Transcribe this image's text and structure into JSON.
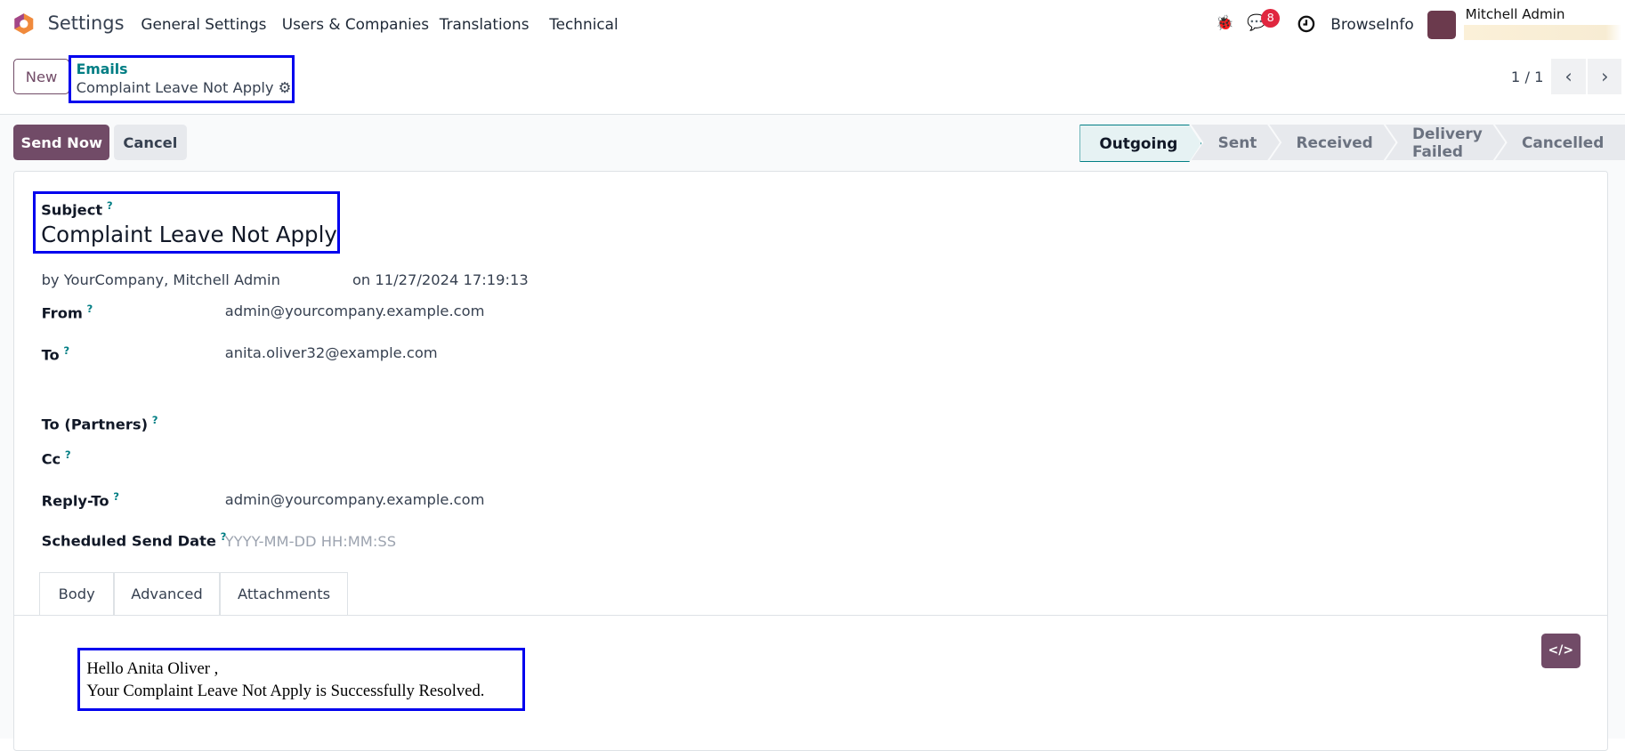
{
  "nav": {
    "app": "Settings",
    "items": [
      "General Settings",
      "Users & Companies",
      "Translations",
      "Technical"
    ],
    "message_count": "8",
    "company": "BrowseInfo",
    "user": "Mitchell Admin"
  },
  "control": {
    "new_label": "New",
    "breadcrumb_parent": "Emails",
    "breadcrumb_current": "Complaint Leave Not Apply",
    "pager": "1 / 1"
  },
  "actions": {
    "send_now": "Send Now",
    "cancel": "Cancel"
  },
  "status": {
    "stages": [
      "Outgoing",
      "Sent",
      "Received",
      "Delivery Failed",
      "Cancelled"
    ],
    "active": "Outgoing"
  },
  "form": {
    "subject_label": "Subject",
    "subject": "Complaint Leave Not Apply",
    "by": "by YourCompany, Mitchell Admin",
    "on": "on 11/27/2024 17:19:13",
    "fields": [
      {
        "label": "From",
        "value": "admin@yourcompany.example.com"
      },
      {
        "label": "To",
        "value": "anita.oliver32@example.com"
      },
      {
        "label": "To (Partners)",
        "value": ""
      },
      {
        "label": "Cc",
        "value": ""
      },
      {
        "label": "Reply-To",
        "value": "admin@yourcompany.example.com"
      },
      {
        "label": "Scheduled Send Date",
        "placeholder": "YYYY-MM-DD HH:MM:SS"
      }
    ],
    "help": "?"
  },
  "tabs": [
    "Body",
    "Advanced",
    "Attachments"
  ],
  "body": {
    "line1": "Hello Anita Oliver ,",
    "line2": "Your Complaint Leave Not Apply is Successfully Resolved.",
    "code_label": "</>"
  },
  "colors": {
    "brand": "#714b67",
    "teal": "#017e84",
    "highlight": "#0000ee"
  }
}
